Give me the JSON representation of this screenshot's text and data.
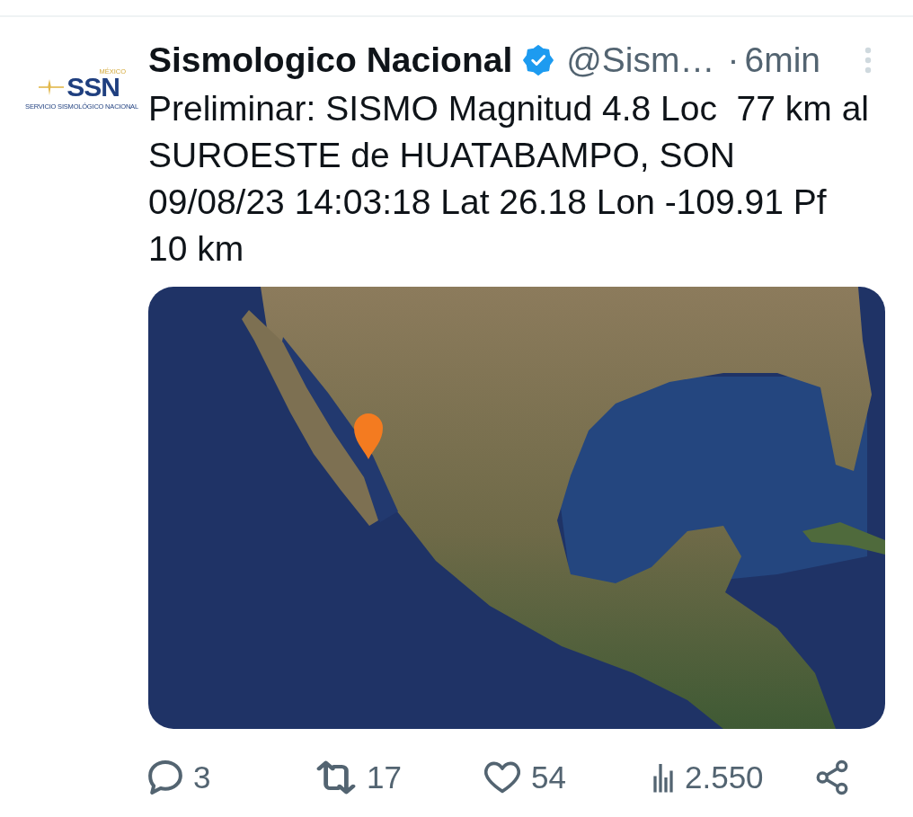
{
  "post": {
    "avatar_logo": {
      "country": "MÉXICO",
      "acronym": "SSN",
      "tagline": "SERVICIO SISMOLÓGICO NACIONAL"
    },
    "author": {
      "name": "Sismologico Nacional",
      "verified": true,
      "handle": "@Sism…"
    },
    "separator": "·",
    "time": "6min",
    "text": "Preliminar: SISMO Magnitud 4.8 Loc  77 km al SUROESTE de HUATABAMPO, SON\n09/08/23 14:03:18 Lat 26.18 Lon -109.91 Pf 10 km",
    "media": {
      "kind": "map"
    },
    "actions": [
      {
        "kind": "reply",
        "count": "3"
      },
      {
        "kind": "repost",
        "count": "17"
      },
      {
        "kind": "like",
        "count": "54"
      },
      {
        "kind": "views",
        "count": "2.550"
      },
      {
        "kind": "share"
      }
    ]
  }
}
